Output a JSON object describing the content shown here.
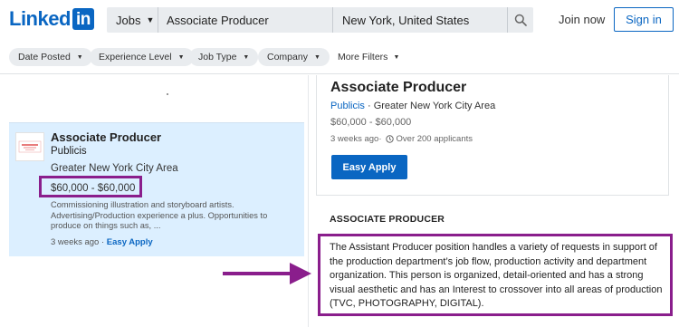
{
  "header": {
    "logo_word": "Linked",
    "logo_in": "in",
    "search": {
      "category": "Jobs",
      "keywords": "Associate Producer",
      "location": "New York, United States"
    },
    "join_label": "Join now",
    "signin_label": "Sign in"
  },
  "filters": {
    "items": [
      "Date Posted",
      "Experience Level",
      "Job Type",
      "Company"
    ],
    "more_label": "More Filters"
  },
  "job_card": {
    "title": "Associate Producer",
    "company": "Publicis",
    "location": "Greater New York City Area",
    "salary": "$60,000 - $60,000",
    "snippet": "Commissioning illustration and storyboard artists. Advertising/Production experience a plus. Opportunities to produce on things such as, ...",
    "posted": "3 weeks ago",
    "separator": " · ",
    "easy_apply": "Easy Apply"
  },
  "detail": {
    "title": "Associate Producer",
    "company": "Publicis",
    "separator": " · ",
    "location": "Greater New York City Area",
    "salary": "$60,000 - $60,000",
    "posted": "3 weeks ago",
    "meta_separator": " · ",
    "applicants": "Over 200 applicants",
    "apply_label": "Easy Apply",
    "section_heading": "ASSOCIATE PRODUCER",
    "description": "The Assistant Producer position handles a variety of requests in support of the production department’s job flow, production activity and department organization. This person is organized, detail-oriented and has a strong visual aesthetic and has an Interest to crossover into all areas of production (TVC, PHOTOGRAPHY, DIGITAL)."
  },
  "colors": {
    "brand": "#0a66c2",
    "annotation": "#8a1e8c",
    "selected_card": "#dcefff"
  }
}
